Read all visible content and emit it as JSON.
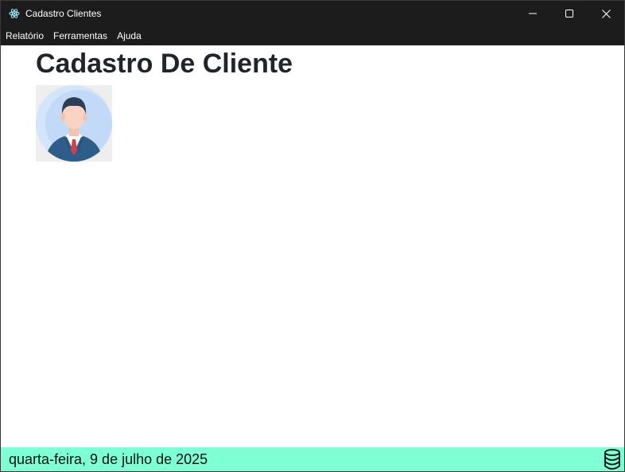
{
  "window": {
    "title": "Cadastro Clientes",
    "app_icon": "electron-atom-icon",
    "controls": [
      "minimize-icon",
      "maximize-icon",
      "close-icon"
    ]
  },
  "menubar": {
    "items": [
      {
        "label": "Relatório"
      },
      {
        "label": "Ferramentas"
      },
      {
        "label": "Ajuda"
      }
    ]
  },
  "main": {
    "title": "Cadastro De Cliente",
    "avatar_icon": "businessman-avatar-icon"
  },
  "statusbar": {
    "date": "quarta-feira, 9 de julho de 2025",
    "icon": "database-icon",
    "background": "#7fffd4"
  }
}
